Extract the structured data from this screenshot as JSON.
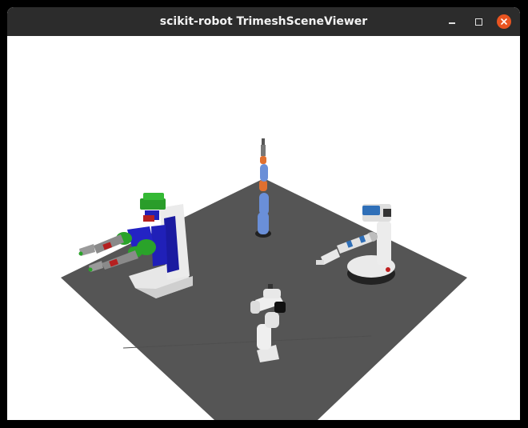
{
  "window": {
    "title": "scikit-robot TrimeshSceneViewer",
    "controls": {
      "minimize": "minimize-icon",
      "maximize": "maximize-icon",
      "close": "close-icon"
    },
    "accent_close": "#e95420"
  },
  "scene": {
    "background": "#ffffff",
    "floor_color": "#555555",
    "objects": [
      "pr2-robot",
      "kinova-arm",
      "fetch-robot",
      "panda-arm"
    ]
  }
}
